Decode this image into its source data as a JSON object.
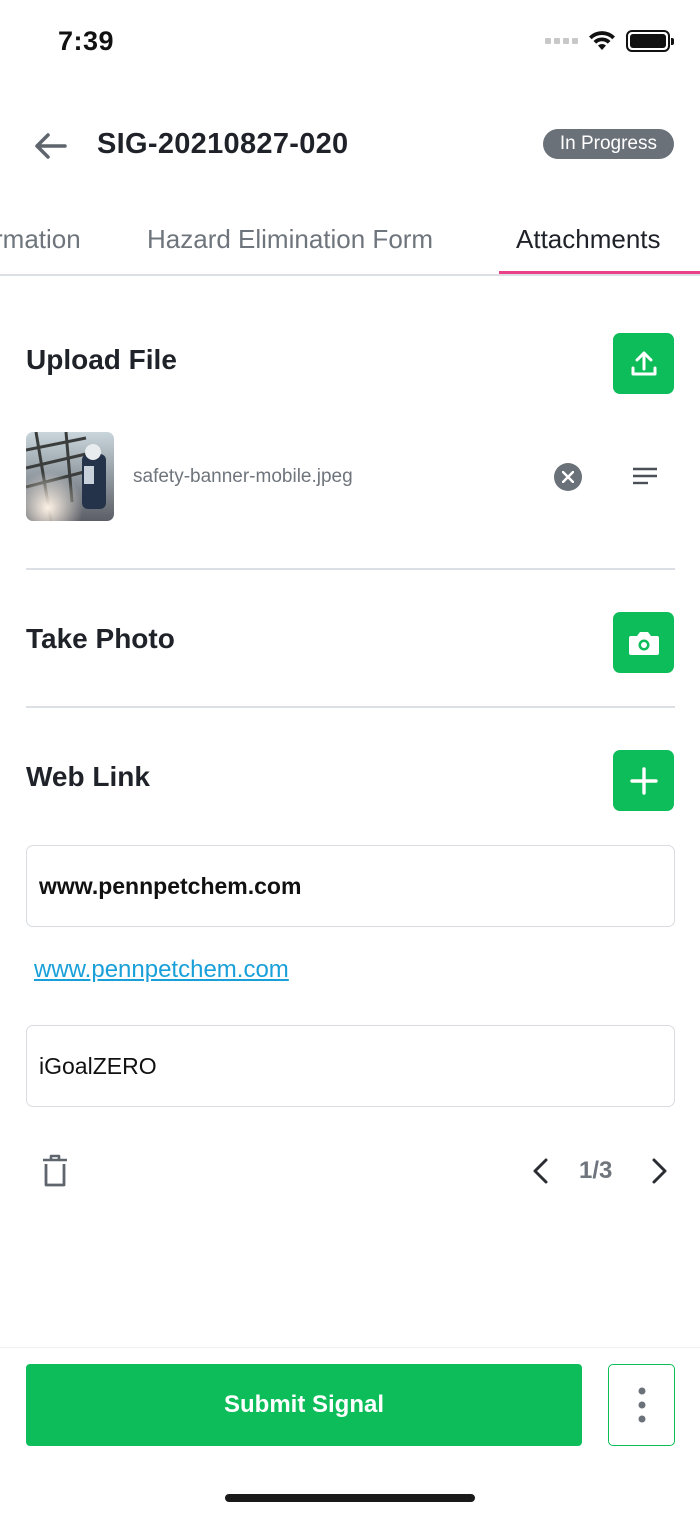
{
  "status_bar": {
    "time": "7:39",
    "icons": [
      "cellular-dots-icon",
      "wifi-icon",
      "battery-icon"
    ]
  },
  "header": {
    "title": "SIG-20210827-020",
    "status": "In Progress"
  },
  "tabs": [
    {
      "label": "rmation",
      "active": false
    },
    {
      "label": "Hazard Elimination Form",
      "active": false
    },
    {
      "label": "Attachments",
      "active": true
    }
  ],
  "upload": {
    "title": "Upload File",
    "file_name": "safety-banner-mobile.jpeg"
  },
  "photo": {
    "title": "Take Photo"
  },
  "web_link": {
    "title": "Web Link",
    "url_value": "www.pennpetchem.com",
    "link_text": "www.pennpetchem.com",
    "label_value": "iGoalZERO",
    "pager": "1/3"
  },
  "footer": {
    "submit_label": "Submit Signal"
  },
  "colors": {
    "accent_green": "#0dbd5a",
    "tab_underline": "#e8418a",
    "link": "#1aa0d9",
    "badge": "#6b7178"
  }
}
